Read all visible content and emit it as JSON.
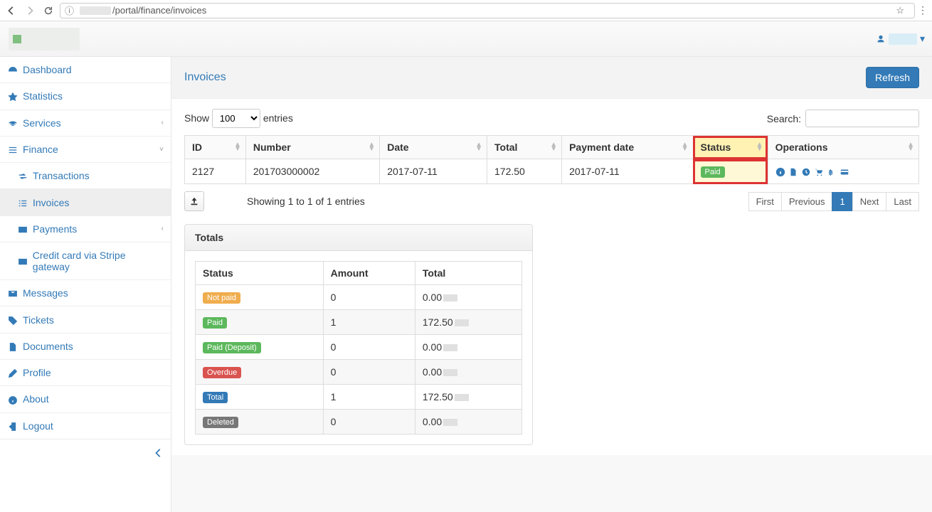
{
  "browser": {
    "url_path": "/portal/finance/invoices"
  },
  "header": {
    "user_menu_caret": "▾"
  },
  "sidebar": {
    "items": [
      {
        "label": "Dashboard",
        "icon": "dashboard"
      },
      {
        "label": "Statistics",
        "icon": "star"
      },
      {
        "label": "Services",
        "icon": "wifi",
        "chev": "‹"
      },
      {
        "label": "Finance",
        "icon": "bars",
        "chev": "˅",
        "expanded": true,
        "children": [
          {
            "label": "Transactions",
            "icon": "exchange"
          },
          {
            "label": "Invoices",
            "icon": "list",
            "active": true
          },
          {
            "label": "Payments",
            "icon": "card",
            "chev": "‹"
          },
          {
            "label": "Credit card via Stripe gateway",
            "icon": "card"
          }
        ]
      },
      {
        "label": "Messages",
        "icon": "envelope"
      },
      {
        "label": "Tickets",
        "icon": "tag"
      },
      {
        "label": "Documents",
        "icon": "file"
      },
      {
        "label": "Profile",
        "icon": "pencil"
      },
      {
        "label": "About",
        "icon": "info"
      },
      {
        "label": "Logout",
        "icon": "signout"
      }
    ]
  },
  "page": {
    "title": "Invoices",
    "refresh": "Refresh"
  },
  "datatable": {
    "length_label_pre": "Show",
    "length_value": "100",
    "length_label_post": "entries",
    "search_label": "Search:",
    "columns": [
      "ID",
      "Number",
      "Date",
      "Total",
      "Payment date",
      "Status",
      "Operations"
    ],
    "rows": [
      {
        "id": "2127",
        "number": "201703000002",
        "date": "2017-07-11",
        "total": "172.50",
        "payment_date": "2017-07-11",
        "status": "Paid"
      }
    ],
    "showing": "Showing 1 to 1 of 1 entries",
    "pagination": {
      "first": "First",
      "prev": "Previous",
      "current": "1",
      "next": "Next",
      "last": "Last"
    }
  },
  "totals": {
    "heading": "Totals",
    "columns": [
      "Status",
      "Amount",
      "Total"
    ],
    "rows": [
      {
        "status": "Not paid",
        "badge": "notpaid",
        "amount": "0",
        "total": "0.00"
      },
      {
        "status": "Paid",
        "badge": "paid",
        "amount": "1",
        "total": "172.50"
      },
      {
        "status": "Paid (Deposit)",
        "badge": "paiddep",
        "amount": "0",
        "total": "0.00"
      },
      {
        "status": "Overdue",
        "badge": "overdue",
        "amount": "0",
        "total": "0.00"
      },
      {
        "status": "Total",
        "badge": "total",
        "amount": "1",
        "total": "172.50"
      },
      {
        "status": "Deleted",
        "badge": "deleted",
        "amount": "0",
        "total": "0.00"
      }
    ]
  }
}
